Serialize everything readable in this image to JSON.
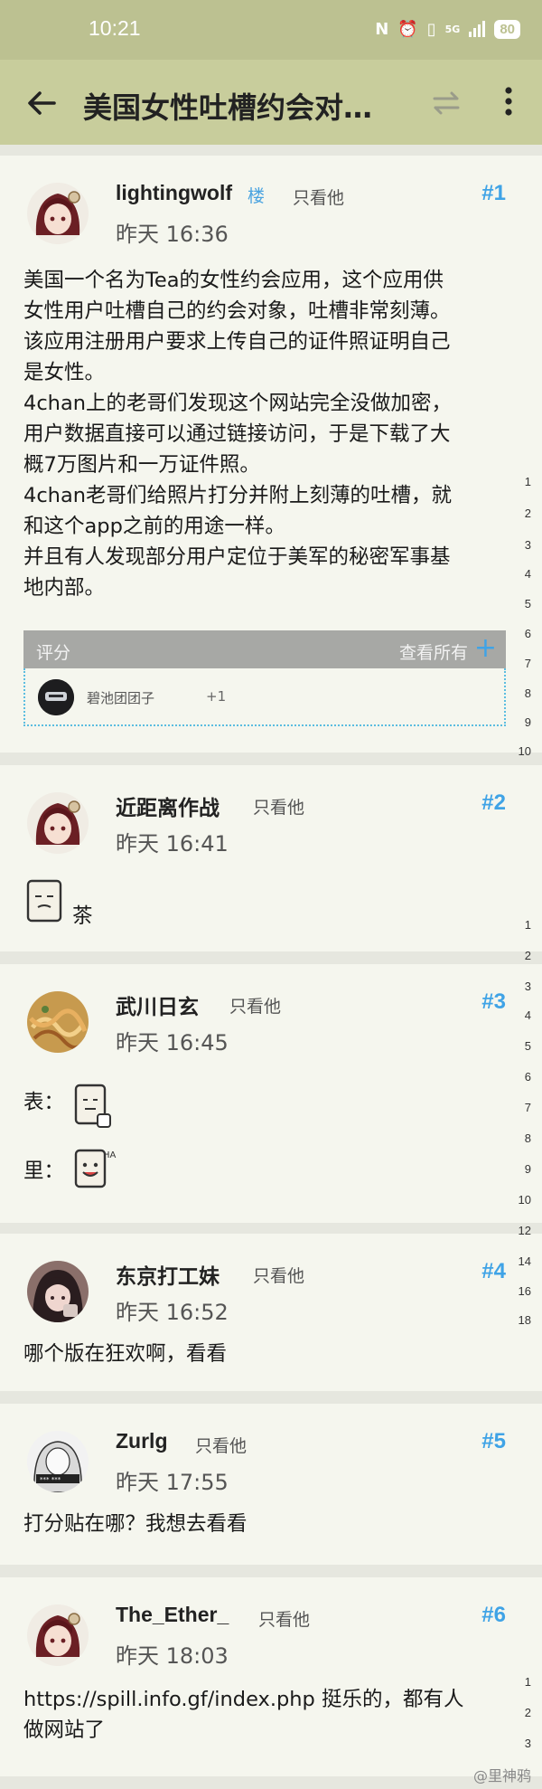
{
  "status": {
    "time": "10:21",
    "battery": "80",
    "network": "5G"
  },
  "header": {
    "title": "美国女性吐槽约会对…"
  },
  "posts": [
    {
      "username": "lightingwolf",
      "badge": "楼",
      "only_him": "只看他",
      "time": "昨天 16:36",
      "floor": "#1",
      "lines": [
        "美国一个名为Tea的女性约会应用，这个应用供",
        "女性用户吐槽自己的约会对象，吐槽非常刻薄。",
        "该应用注册用户要求上传自己的证件照证明自己",
        "是女性。",
        "4chan上的老哥们发现这个网站完全没做加密，",
        "用户数据直接可以通过链接访问，于是下载了大",
        "概7万图片和一万证件照。",
        "4chan老哥们给照片打分并附上刻薄的吐槽，就",
        "和这个app之前的用途一样。",
        "并且有人发现部分用户定位于美军的秘密军事基",
        "地内部。"
      ],
      "ratings": {
        "label": "评分",
        "view_all": "查看所有",
        "user": "碧池团团子",
        "score": "+1"
      }
    },
    {
      "username": "近距离作战",
      "only_him": "只看他",
      "time": "昨天 16:41",
      "floor": "#2",
      "text": "茶"
    },
    {
      "username": "武川日玄",
      "only_him": "只看他",
      "time": "昨天 16:45",
      "floor": "#3",
      "line1": "表：",
      "line2": "里："
    },
    {
      "username": "东京打工妹",
      "only_him": "只看他",
      "time": "昨天 16:52",
      "floor": "#4",
      "text": "哪个版在狂欢啊，看看"
    },
    {
      "username": "Zurlg",
      "only_him": "只看他",
      "time": "昨天 17:55",
      "floor": "#5",
      "text": "打分贴在哪？我想去看看"
    },
    {
      "username": "The_Ether_",
      "only_him": "只看他",
      "time": "昨天 18:03",
      "floor": "#6",
      "lines": [
        "https://spill.info.gf/index.php  挺乐的，都有人",
        "做网站了"
      ]
    }
  ],
  "side_numbers": {
    "p1": [
      "1",
      "2",
      "3",
      "4",
      "5",
      "6",
      "7",
      "8",
      "9",
      "10"
    ],
    "p2": [
      "1",
      "2",
      "3",
      "4",
      "5",
      "6",
      "7",
      "8",
      "9",
      "10",
      "12",
      "14",
      "16",
      "18"
    ],
    "p6": [
      "1",
      "2",
      "3"
    ]
  },
  "watermark": "@里神鸦",
  "colors": {
    "status_bar": "#bcc191",
    "app_bar": "#c8cd9c",
    "floor": "#3fa3e6",
    "card": "#f5f6ee"
  }
}
